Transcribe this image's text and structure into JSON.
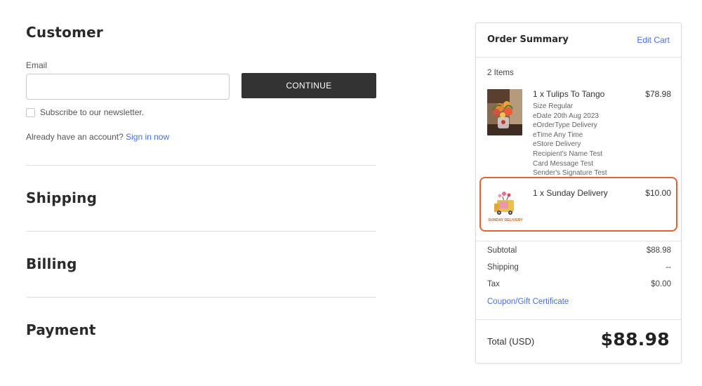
{
  "customer": {
    "title": "Customer",
    "email_label": "Email",
    "email_value": "",
    "continue_label": "CONTINUE",
    "newsletter_label": "Subscribe to our newsletter.",
    "account_prompt": "Already have an account?",
    "sign_in_label": "Sign in now"
  },
  "sections": {
    "shipping": "Shipping",
    "billing": "Billing",
    "payment": "Payment"
  },
  "summary": {
    "title": "Order Summary",
    "edit_cart_label": "Edit Cart",
    "item_count": "2 Items",
    "items": [
      {
        "name": "1 x Tulips To Tango",
        "price": "$78.98",
        "options": [
          "Size Regular",
          "eDate 20th Aug 2023",
          "eOrderType Delivery",
          "eTime Any Time",
          "eStore Delivery",
          "Recipient's Name Test",
          "Card Message Test",
          "Sender's Signature Test"
        ],
        "thumb_icon": "tulip-bouquet-image"
      },
      {
        "name": "1 x Sunday Delivery",
        "price": "$10.00",
        "thumb_icon": "sunday-delivery-logo",
        "thumb_caption": "SUNDAY DELIVERY"
      }
    ],
    "subtotal_label": "Subtotal",
    "subtotal_value": "$88.98",
    "shipping_label": "Shipping",
    "shipping_value": "--",
    "tax_label": "Tax",
    "tax_value": "$0.00",
    "coupon_label": "Coupon/Gift Certificate",
    "total_label": "Total (USD)",
    "total_value": "$88.98"
  },
  "colors": {
    "accent_link": "#4a6ee0",
    "button_bg": "#333333",
    "highlight_border": "#e8622e"
  }
}
